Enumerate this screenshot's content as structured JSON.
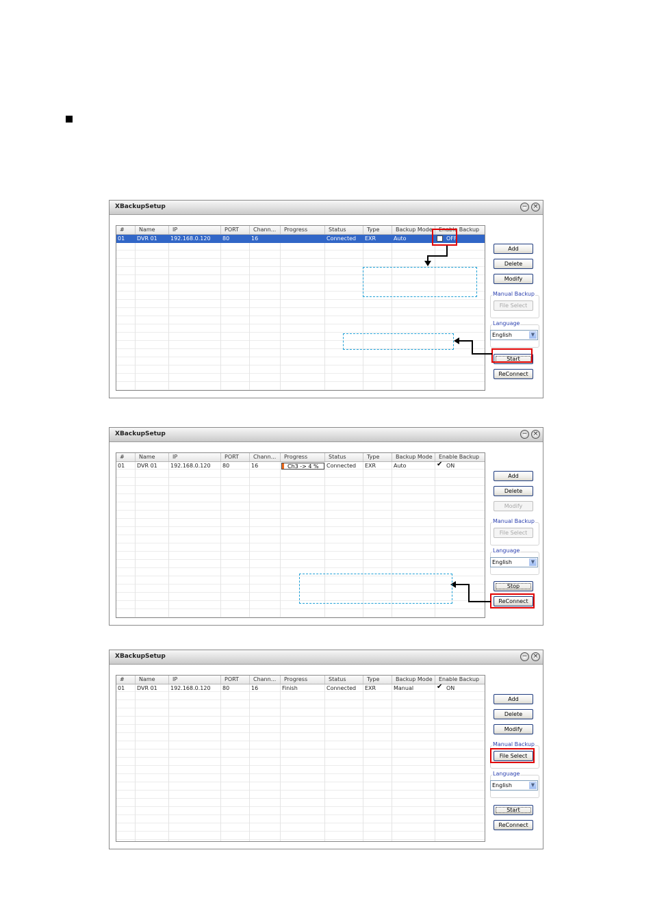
{
  "window_title": "XBackupSetup",
  "title_buttons": {
    "minimize": "−",
    "close": "×"
  },
  "columns": [
    "#",
    "Name",
    "IP",
    "PORT",
    "Chann...",
    "Progress",
    "Status",
    "Type",
    "Backup Mode",
    "Enable Backup"
  ],
  "manual_backup_label": "Manual Backup",
  "language_label": "Language",
  "windows": [
    {
      "row": {
        "num": "01",
        "name": "DVR 01",
        "ip": "192.168.0.120",
        "port": "80",
        "channels": "16",
        "progress": "",
        "status": "Connected",
        "type": "EXR",
        "backup_mode": "Auto",
        "enable_checked": false,
        "enable_text": "OFF"
      },
      "buttons": {
        "add": "Add",
        "delete": "Delete",
        "modify": "Modify",
        "file_select": "File Select",
        "start": "Start",
        "reconnect": "ReConnect"
      },
      "language_value": "English"
    },
    {
      "row": {
        "num": "01",
        "name": "DVR 01",
        "ip": "192.168.0.120",
        "port": "80",
        "channels": "16",
        "progress_text": "Ch3 -> 4 %",
        "progress_percent": 4,
        "status": "Connected",
        "type": "EXR",
        "backup_mode": "Auto",
        "enable_checked": true,
        "enable_text": "ON"
      },
      "buttons": {
        "add": "Add",
        "delete": "Delete",
        "modify": "Modify",
        "file_select": "File Select",
        "stop": "Stop",
        "reconnect": "ReConnect"
      },
      "language_value": "English"
    },
    {
      "row": {
        "num": "01",
        "name": "DVR 01",
        "ip": "192.168.0.120",
        "port": "80",
        "channels": "16",
        "progress": "Finish",
        "status": "Connected",
        "type": "EXR",
        "backup_mode": "Manual",
        "enable_checked": true,
        "enable_text": "ON"
      },
      "buttons": {
        "add": "Add",
        "delete": "Delete",
        "modify": "Modify",
        "file_select": "File Select",
        "start": "Start",
        "reconnect": "ReConnect"
      },
      "language_value": "English"
    }
  ],
  "colors": {
    "highlight": "#e00000",
    "callout": "#1fa0d6",
    "selection": "#3166c7",
    "progress": "#ee6a1c"
  },
  "icons": {
    "select_arrow": "chevron-down-icon",
    "check": "checkmark-icon"
  }
}
